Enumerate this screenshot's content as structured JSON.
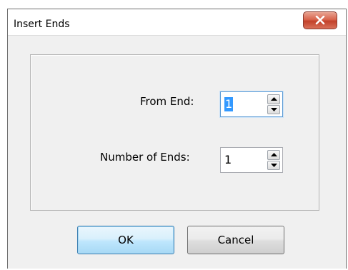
{
  "window": {
    "title": "Insert Ends",
    "close_icon": "close-x-icon"
  },
  "form": {
    "from_end": {
      "label": "From End:",
      "value": "1"
    },
    "number_of_ends": {
      "label": "Number of Ends:",
      "value": "1"
    }
  },
  "buttons": {
    "ok": "OK",
    "cancel": "Cancel"
  },
  "colors": {
    "close_button": "#c2412a",
    "default_button_border": "#3c7fb1",
    "selection": "#3399ff"
  }
}
